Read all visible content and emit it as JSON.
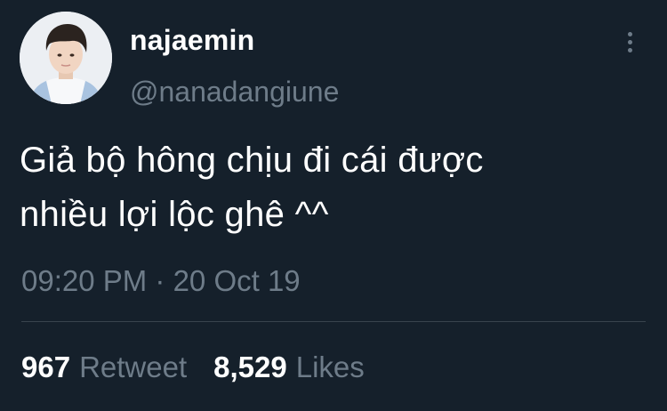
{
  "author": {
    "display_name": "najaemin",
    "handle": "@nanadangiune",
    "avatar": "profile-photo"
  },
  "tweet": {
    "text_lines": [
      "Giả bộ hông chịu đi cái được",
      "nhiều lợi lộc ghê ^^"
    ],
    "timestamp": "09:20 PM · 20 Oct 19"
  },
  "stats": {
    "retweets_count": "967",
    "retweets_label": "Retweet",
    "likes_count": "8,529",
    "likes_label": "Likes"
  },
  "icons": {
    "more": "more-vertical-icon"
  },
  "colors": {
    "background": "#15202b",
    "primary_text": "#ffffff",
    "secondary_text": "#6e7c89",
    "divider": "#38444d"
  }
}
